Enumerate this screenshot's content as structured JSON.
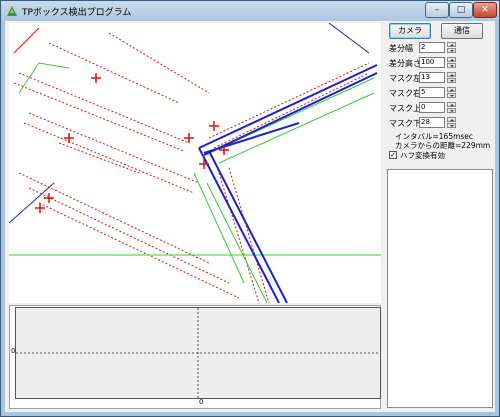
{
  "window": {
    "title": "TPボックス検出プログラム"
  },
  "caption": {
    "minimize": "–",
    "maximize": "□",
    "close": "✕"
  },
  "buttons": {
    "camera": "カメラ",
    "comm": "通信"
  },
  "params": [
    {
      "label": "差分幅",
      "value": "2"
    },
    {
      "label": "差分高さ",
      "value": "100"
    },
    {
      "label": "マスク左",
      "value": "13"
    },
    {
      "label": "マスク右",
      "value": "5"
    },
    {
      "label": "マスク上",
      "value": "0"
    },
    {
      "label": "マスク下",
      "value": "28"
    }
  ],
  "info": {
    "interval": "インタバル=165msec",
    "distance": "カメラからの距離=229mm"
  },
  "hough": {
    "label": "ハフ変換有効",
    "checked": true
  },
  "graph": {
    "y_tick": "0",
    "x_tick": "0"
  },
  "colors": {
    "edge": "#dd1111",
    "line": "#1a22cc",
    "green": "#33cc33"
  }
}
